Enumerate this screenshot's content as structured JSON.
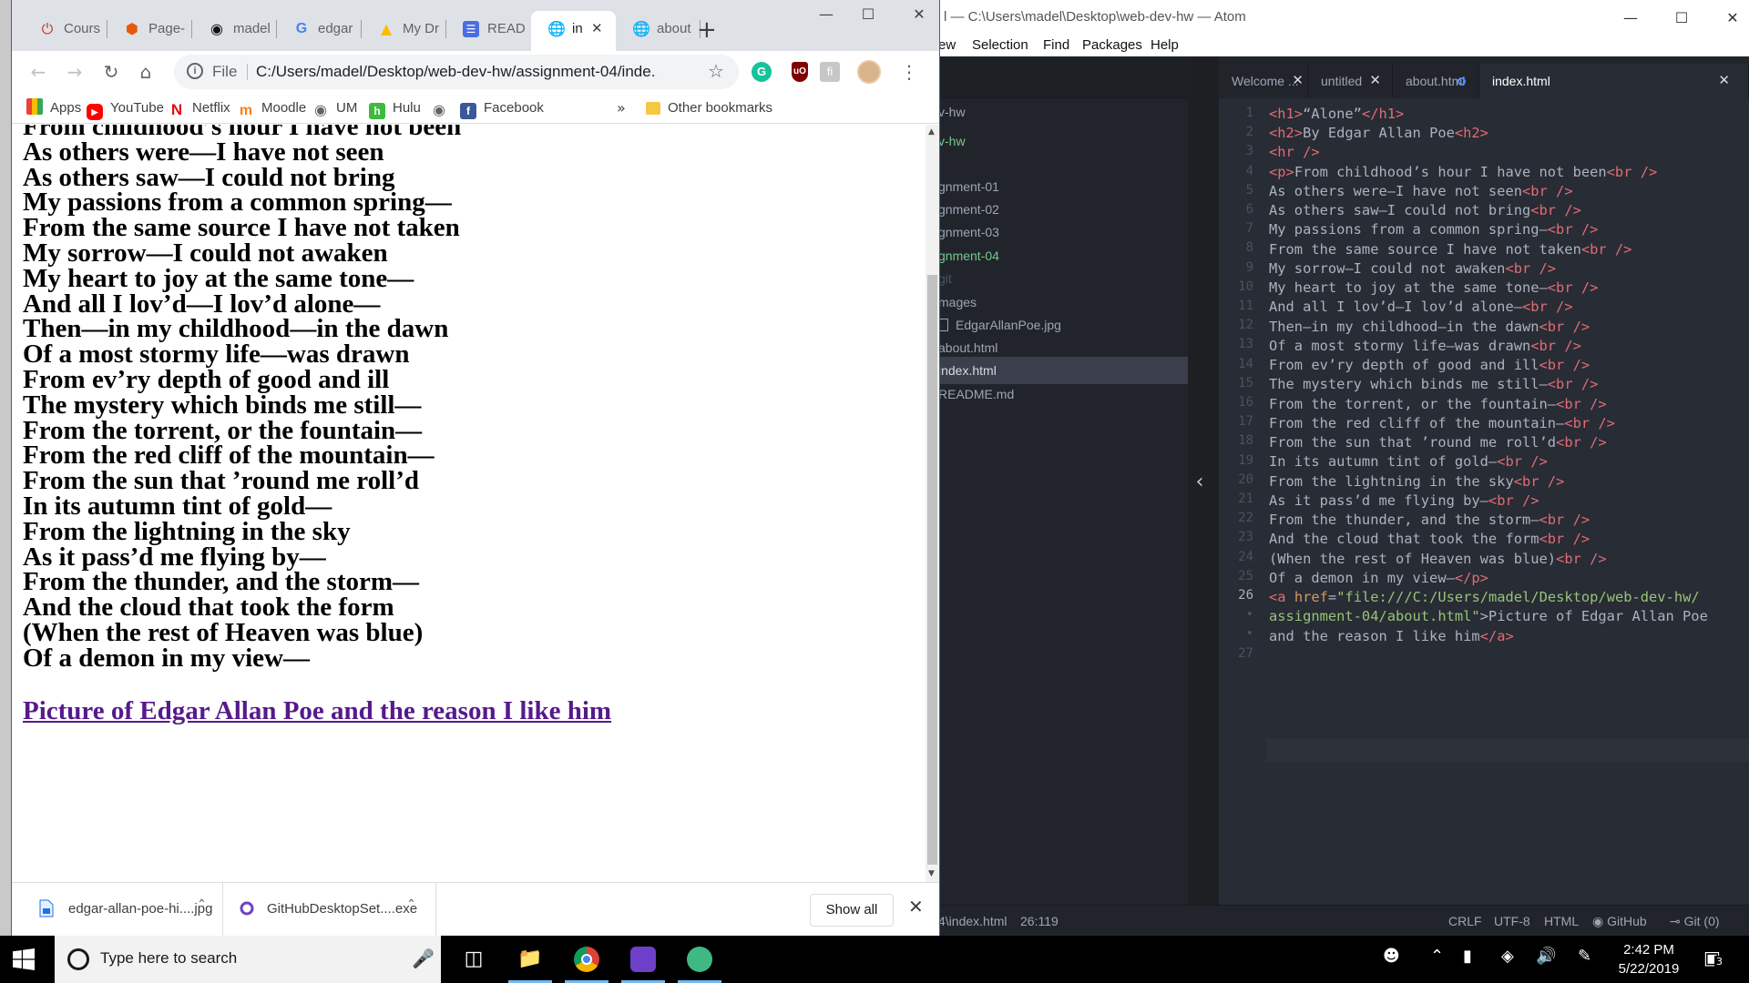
{
  "atom": {
    "title": "l — C:\\Users\\madel\\Desktop\\web-dev-hw — Atom",
    "menu": [
      "ew",
      "Selection",
      "Find",
      "Packages",
      "Help"
    ],
    "tree": [
      "v-hw",
      "v-hw",
      "gnment-01",
      "gnment-02",
      "gnment-03",
      "gnment-04",
      "git",
      "mages",
      "EdgarAllanPoe.jpg",
      "about.html",
      "index.html",
      "README.md"
    ],
    "tabs": [
      "Welcome ...",
      "untitled",
      "about.html",
      "index.html"
    ],
    "line_numbers": [
      "1",
      "2",
      "3",
      "4",
      "5",
      "6",
      "7",
      "8",
      "9",
      "10",
      "11",
      "12",
      "13",
      "14",
      "15",
      "16",
      "17",
      "18",
      "19",
      "20",
      "21",
      "22",
      "23",
      "24",
      "25",
      "26",
      "•",
      "•",
      "27"
    ],
    "status": {
      "path": "4\\index.html",
      "cursor": "26:119",
      "line_ending": "CRLF",
      "encoding": "UTF-8",
      "grammar": "HTML",
      "github": "GitHub",
      "git": "Git (0)"
    }
  },
  "chrome": {
    "tabs": [
      "Cours",
      "Page-",
      "madel",
      "edgar",
      "My Dr",
      "READI",
      "in",
      "about"
    ],
    "omnibox": {
      "scheme": "File",
      "url": "C:/Users/madel/Desktop/web-dev-hw/assignment-04/inde..."
    },
    "bookmarks": [
      "Apps",
      "YouTube",
      "Netflix",
      "Moodle",
      "UM",
      "Hulu",
      "Facebook"
    ],
    "other_bookmarks": "Other bookmarks",
    "poem_lines": [
      "From childhood’s hour I have not been",
      "As others were—I have not seen",
      "As others saw—I could not bring",
      "My passions from a common spring—",
      "From the same source I have not taken",
      "My sorrow—I could not awaken",
      "My heart to joy at the same tone—",
      "And all I lov’d—I lov’d alone—",
      "Then—in my childhood—in the dawn",
      "Of a most stormy life—was drawn",
      "From ev’ry depth of good and ill",
      "The mystery which binds me still—",
      "From the torrent, or the fountain—",
      "From the red cliff of the mountain—",
      "From the sun that ’round me roll’d",
      "In its autumn tint of gold—",
      "From the lightning in the sky",
      "As it pass’d me flying by—",
      "From the thunder, and the storm—",
      "And the cloud that took the form",
      "(When the rest of Heaven was blue)",
      "Of a demon in my view—"
    ],
    "link_text": "Picture of Edgar Allan Poe and the reason I like him",
    "downloads": [
      "edgar-allan-poe-hi....jpg",
      "GitHubDesktopSet....exe"
    ],
    "show_all": "Show all"
  },
  "taskbar": {
    "search_placeholder": "Type here to search",
    "time": "2:42 PM",
    "date": "5/22/2019",
    "notification_count": "3"
  }
}
